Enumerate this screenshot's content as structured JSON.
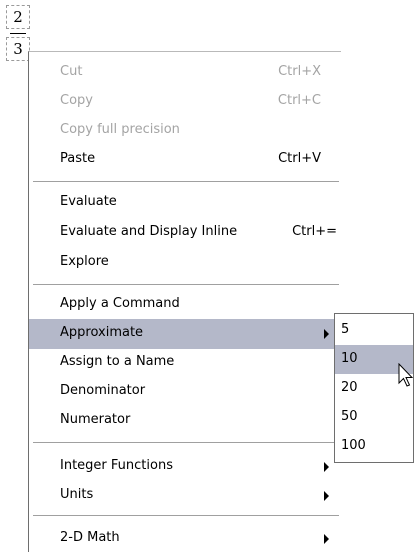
{
  "fraction": {
    "numerator": "2",
    "denominator": "3"
  },
  "menu": {
    "groups": [
      {
        "items": [
          {
            "label": "Cut",
            "shortcut": "Ctrl+X",
            "disabled": true
          },
          {
            "label": "Copy",
            "shortcut": "Ctrl+C",
            "disabled": true
          },
          {
            "label": "Copy full precision",
            "shortcut": "",
            "disabled": true
          },
          {
            "label": "Paste",
            "shortcut": "Ctrl+V",
            "disabled": false
          }
        ]
      },
      {
        "items": [
          {
            "label": "Evaluate",
            "shortcut": ""
          },
          {
            "label": "Evaluate and Display Inline",
            "shortcut": "Ctrl+="
          },
          {
            "label": "Explore",
            "shortcut": ""
          }
        ]
      },
      {
        "items": [
          {
            "label": "Apply a Command",
            "shortcut": ""
          },
          {
            "label": "Approximate",
            "shortcut": "",
            "submenu": true,
            "highlighted": true
          },
          {
            "label": "Assign to a Name",
            "shortcut": ""
          },
          {
            "label": "Denominator",
            "shortcut": ""
          },
          {
            "label": "Numerator",
            "shortcut": ""
          }
        ]
      },
      {
        "items": [
          {
            "label": "Integer Functions",
            "shortcut": "",
            "submenu": true
          },
          {
            "label": "Units",
            "shortcut": "",
            "submenu": true
          }
        ]
      },
      {
        "items": [
          {
            "label": "2-D Math",
            "shortcut": "",
            "submenu": true
          }
        ]
      }
    ]
  },
  "submenu": {
    "parent": "Approximate",
    "items": [
      {
        "label": "5"
      },
      {
        "label": "10",
        "highlighted": true
      },
      {
        "label": "20"
      },
      {
        "label": "50"
      },
      {
        "label": "100"
      }
    ]
  },
  "colors": {
    "highlight": "#b4b8c9",
    "disabled_text": "#a4a4a4",
    "separator": "#a0a0a0"
  }
}
